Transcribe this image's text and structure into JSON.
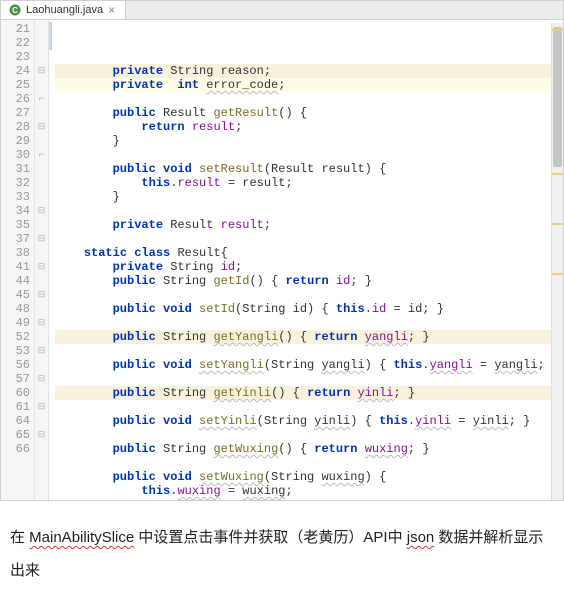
{
  "tab": {
    "filename": "Laohuangli.java"
  },
  "lines": [
    {
      "n": 21,
      "fold": "",
      "cls": "warn-line",
      "indent": 2,
      "tokens": [
        {
          "t": "private ",
          "c": "kw"
        },
        {
          "t": "String reason;",
          "c": ""
        }
      ]
    },
    {
      "n": 22,
      "fold": "",
      "cls": "hl-line",
      "indent": 2,
      "tokens": [
        {
          "t": "private  int ",
          "c": "kw"
        },
        {
          "t": "error_code",
          "c": "squig"
        },
        {
          "t": ";",
          "c": ""
        }
      ]
    },
    {
      "n": 23,
      "fold": "",
      "cls": "",
      "indent": 0,
      "tokens": []
    },
    {
      "n": 24,
      "fold": "⊟",
      "cls": "",
      "indent": 2,
      "tokens": [
        {
          "t": "public ",
          "c": "kw"
        },
        {
          "t": "Result ",
          "c": ""
        },
        {
          "t": "getResult",
          "c": "mtd"
        },
        {
          "t": "() {",
          "c": ""
        }
      ]
    },
    {
      "n": 25,
      "fold": "",
      "cls": "",
      "indent": 3,
      "tokens": [
        {
          "t": "return ",
          "c": "kw"
        },
        {
          "t": "result",
          "c": "fld"
        },
        {
          "t": ";",
          "c": ""
        }
      ]
    },
    {
      "n": 26,
      "fold": "⌐",
      "cls": "",
      "indent": 2,
      "tokens": [
        {
          "t": "}",
          "c": ""
        }
      ]
    },
    {
      "n": 27,
      "fold": "",
      "cls": "",
      "indent": 0,
      "tokens": []
    },
    {
      "n": 28,
      "fold": "⊟",
      "cls": "",
      "indent": 2,
      "tokens": [
        {
          "t": "public void ",
          "c": "kw"
        },
        {
          "t": "setResult",
          "c": "mtd"
        },
        {
          "t": "(Result result) {",
          "c": ""
        }
      ]
    },
    {
      "n": 29,
      "fold": "",
      "cls": "",
      "indent": 3,
      "tokens": [
        {
          "t": "this",
          "c": "kw"
        },
        {
          "t": ".",
          "c": ""
        },
        {
          "t": "result",
          "c": "fld"
        },
        {
          "t": " = result;",
          "c": ""
        }
      ]
    },
    {
      "n": 30,
      "fold": "⌐",
      "cls": "",
      "indent": 2,
      "tokens": [
        {
          "t": "}",
          "c": ""
        }
      ]
    },
    {
      "n": 31,
      "fold": "",
      "cls": "",
      "indent": 0,
      "tokens": []
    },
    {
      "n": 32,
      "fold": "",
      "cls": "",
      "indent": 2,
      "tokens": [
        {
          "t": "private ",
          "c": "kw"
        },
        {
          "t": "Result ",
          "c": ""
        },
        {
          "t": "result",
          "c": "fld"
        },
        {
          "t": ";",
          "c": ""
        }
      ]
    },
    {
      "n": 33,
      "fold": "",
      "cls": "",
      "indent": 0,
      "tokens": []
    },
    {
      "n": 34,
      "fold": "⊟",
      "cls": "",
      "indent": 1,
      "tokens": [
        {
          "t": "static class ",
          "c": "kw"
        },
        {
          "t": "Result{",
          "c": ""
        }
      ]
    },
    {
      "n": 35,
      "fold": "",
      "cls": "",
      "indent": 2,
      "tokens": [
        {
          "t": "private ",
          "c": "kw"
        },
        {
          "t": "String ",
          "c": ""
        },
        {
          "t": "id",
          "c": "fld"
        },
        {
          "t": ";",
          "c": ""
        }
      ]
    },
    {
      "n": 37,
      "fold": "⊟",
      "cls": "",
      "indent": 2,
      "tokens": [
        {
          "t": "public ",
          "c": "kw"
        },
        {
          "t": "String ",
          "c": ""
        },
        {
          "t": "getId",
          "c": "mtd"
        },
        {
          "t": "() { ",
          "c": ""
        },
        {
          "t": "return ",
          "c": "kw"
        },
        {
          "t": "id",
          "c": "fld"
        },
        {
          "t": "; }",
          "c": ""
        }
      ]
    },
    {
      "n": 38,
      "fold": "",
      "cls": "",
      "indent": 0,
      "tokens": []
    },
    {
      "n": 41,
      "fold": "⊟",
      "cls": "",
      "indent": 2,
      "tokens": [
        {
          "t": "public void ",
          "c": "kw"
        },
        {
          "t": "setId",
          "c": "mtd"
        },
        {
          "t": "(String id) { ",
          "c": ""
        },
        {
          "t": "this",
          "c": "kw"
        },
        {
          "t": ".",
          "c": ""
        },
        {
          "t": "id",
          "c": "fld"
        },
        {
          "t": " = id; }",
          "c": ""
        }
      ]
    },
    {
      "n": 44,
      "fold": "",
      "cls": "",
      "indent": 0,
      "tokens": []
    },
    {
      "n": 45,
      "fold": "⊟",
      "cls": "warn-line",
      "indent": 2,
      "tokens": [
        {
          "t": "public ",
          "c": "kw"
        },
        {
          "t": "String ",
          "c": ""
        },
        {
          "t": "getYangli",
          "c": "mtd squig"
        },
        {
          "t": "() { ",
          "c": ""
        },
        {
          "t": "return ",
          "c": "kw"
        },
        {
          "t": "yangli",
          "c": "fld squig"
        },
        {
          "t": "; }",
          "c": ""
        }
      ]
    },
    {
      "n": 48,
      "fold": "",
      "cls": "",
      "indent": 0,
      "tokens": []
    },
    {
      "n": 49,
      "fold": "⊟",
      "cls": "",
      "indent": 2,
      "tokens": [
        {
          "t": "public void ",
          "c": "kw"
        },
        {
          "t": "setYangli",
          "c": "mtd squig"
        },
        {
          "t": "(String ",
          "c": ""
        },
        {
          "t": "yangli",
          "c": "squig"
        },
        {
          "t": ") { ",
          "c": ""
        },
        {
          "t": "this",
          "c": "kw"
        },
        {
          "t": ".",
          "c": ""
        },
        {
          "t": "yangli",
          "c": "fld squig"
        },
        {
          "t": " = ",
          "c": ""
        },
        {
          "t": "yangli",
          "c": "squig"
        },
        {
          "t": "; }",
          "c": ""
        }
      ]
    },
    {
      "n": 52,
      "fold": "",
      "cls": "",
      "indent": 0,
      "tokens": []
    },
    {
      "n": 53,
      "fold": "⊟",
      "cls": "warn-line",
      "indent": 2,
      "tokens": [
        {
          "t": "public ",
          "c": "kw"
        },
        {
          "t": "String ",
          "c": ""
        },
        {
          "t": "getYinli",
          "c": "mtd squig"
        },
        {
          "t": "() { ",
          "c": ""
        },
        {
          "t": "return ",
          "c": "kw"
        },
        {
          "t": "yinli",
          "c": "fld squig"
        },
        {
          "t": "; }",
          "c": ""
        }
      ]
    },
    {
      "n": 56,
      "fold": "",
      "cls": "",
      "indent": 0,
      "tokens": []
    },
    {
      "n": 57,
      "fold": "⊟",
      "cls": "",
      "indent": 2,
      "tokens": [
        {
          "t": "public void ",
          "c": "kw"
        },
        {
          "t": "setYinli",
          "c": "mtd squig"
        },
        {
          "t": "(String ",
          "c": ""
        },
        {
          "t": "yinli",
          "c": "squig"
        },
        {
          "t": ") { ",
          "c": ""
        },
        {
          "t": "this",
          "c": "kw"
        },
        {
          "t": ".",
          "c": ""
        },
        {
          "t": "yinli",
          "c": "fld squig"
        },
        {
          "t": " = ",
          "c": ""
        },
        {
          "t": "yinli",
          "c": "squig"
        },
        {
          "t": "; }",
          "c": ""
        }
      ]
    },
    {
      "n": 60,
      "fold": "",
      "cls": "",
      "indent": 0,
      "tokens": []
    },
    {
      "n": 61,
      "fold": "⊟",
      "cls": "",
      "indent": 2,
      "tokens": [
        {
          "t": "public ",
          "c": "kw"
        },
        {
          "t": "String ",
          "c": ""
        },
        {
          "t": "getWuxing",
          "c": "mtd squig"
        },
        {
          "t": "() { ",
          "c": ""
        },
        {
          "t": "return ",
          "c": "kw"
        },
        {
          "t": "wuxing",
          "c": "fld squig"
        },
        {
          "t": "; }",
          "c": ""
        }
      ]
    },
    {
      "n": 64,
      "fold": "",
      "cls": "",
      "indent": 0,
      "tokens": []
    },
    {
      "n": 65,
      "fold": "⊟",
      "cls": "",
      "indent": 2,
      "tokens": [
        {
          "t": "public void ",
          "c": "kw"
        },
        {
          "t": "setWuxing",
          "c": "mtd squig"
        },
        {
          "t": "(String ",
          "c": ""
        },
        {
          "t": "wuxing",
          "c": "squig"
        },
        {
          "t": ") {",
          "c": ""
        }
      ]
    },
    {
      "n": 66,
      "fold": "",
      "cls": "",
      "indent": 3,
      "tokens": [
        {
          "t": "this",
          "c": "kw"
        },
        {
          "t": ".",
          "c": ""
        },
        {
          "t": "wuxing",
          "c": "fld squig"
        },
        {
          "t": " = ",
          "c": ""
        },
        {
          "t": "wuxing",
          "c": "squig"
        },
        {
          "t": ";",
          "c": ""
        }
      ]
    }
  ],
  "caption": {
    "parts": [
      {
        "t": "在 ",
        "u": false
      },
      {
        "t": "MainAbilitySlice",
        "u": true
      },
      {
        "t": " 中设置点击事件并获取（老黄历）API中 ",
        "u": false
      },
      {
        "t": "json",
        "u": true
      },
      {
        "t": " 数据并解析显示出来",
        "u": false
      }
    ]
  }
}
